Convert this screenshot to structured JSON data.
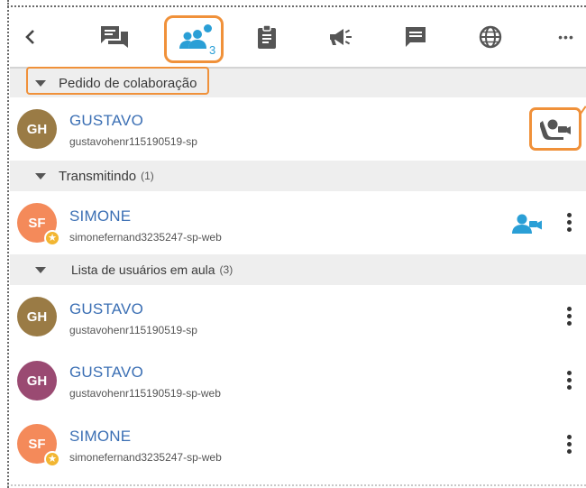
{
  "toolbar": {
    "items": [
      {
        "icon": "chevron-left-icon"
      },
      {
        "icon": "chat-bubbles-icon"
      },
      {
        "icon": "people-icon",
        "badge": "3"
      },
      {
        "icon": "clipboard-icon"
      },
      {
        "icon": "megaphone-icon"
      },
      {
        "icon": "message-icon"
      },
      {
        "icon": "globe-icon"
      },
      {
        "icon": "more-icon",
        "label": "•••"
      }
    ],
    "accent": "#2a9fd6",
    "highlight": "#f0913a"
  },
  "sections": {
    "requests": {
      "title": "Pedido de colaboração",
      "count": ""
    },
    "broadcasting": {
      "title": "Transmitindo",
      "count": "(1)"
    },
    "class_users": {
      "title": "Lista de usuários em aula",
      "count": "(3)"
    }
  },
  "requests": [
    {
      "initials": "GH",
      "name": "GUSTAVO",
      "id": "gustavohenr115190519-sp",
      "color": "#9a7b45"
    }
  ],
  "broadcasting": [
    {
      "initials": "SF",
      "name": "SIMONE",
      "id": "simonefernand3235247-sp-web",
      "color": "#f48a5a",
      "star": "★"
    }
  ],
  "class_users": [
    {
      "initials": "GH",
      "name": "GUSTAVO",
      "id": "gustavohenr115190519-sp",
      "color": "#9a7b45"
    },
    {
      "initials": "GH",
      "name": "GUSTAVO",
      "id": "gustavohenr115190519-sp-web",
      "color": "#9a4a72"
    },
    {
      "initials": "SF",
      "name": "SIMONE",
      "id": "simonefernand3235247-sp-web",
      "color": "#f48a5a",
      "star": "★"
    }
  ]
}
